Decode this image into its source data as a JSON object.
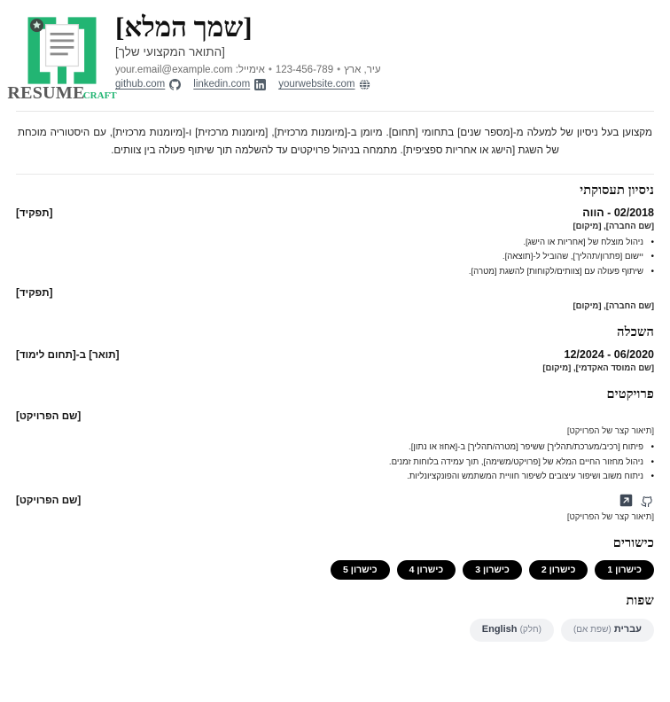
{
  "header": {
    "full_name": "[שמך המלא]",
    "job_title": "[התואר המקצועי שלך]",
    "location": "עיר, ארץ",
    "phone": "123-456-789",
    "email_label": "אימייל:",
    "email": "your.email@example.com",
    "separator": "•",
    "links": [
      {
        "icon": "github-icon",
        "text": "github.com"
      },
      {
        "icon": "linkedin-icon",
        "text": "linkedin.com"
      },
      {
        "icon": "globe-icon",
        "text": "yourwebsite.com"
      }
    ],
    "logo": {
      "word_primary": "RESUME",
      "word_secondary": "CRAFT",
      "brand_green": "#22b573",
      "brand_gray": "#595959"
    }
  },
  "summary": {
    "text": "מקצוען בעל ניסיון של למעלה מ-[מספר שנים] בתחומי [תחום]. מיומן ב-[מיומנות מרכזית], [מיומנות מרכזית] ו-[מיומנות מרכזית], עם היסטוריה מוכחת של השגת [הישג או אחריות ספציפית]. מתמחה בניהול פרויקטים עד להשלמה תוך שיתוף פעולה בין צוותים."
  },
  "experience": {
    "title": "ניסיון תעסוקתי",
    "entries": [
      {
        "role": "[תפקיד]",
        "date": "02/2018 - הווה",
        "sub": "[שם החברה], [מיקום]",
        "bullets": [
          "ניהול מוצלח של [אחריות או הישג].",
          "יישום [פתרון/תהליך], שהוביל ל-[תוצאה].",
          "שיתוף פעולה עם [צוותים/לקוחות] להשגת [מטרה]."
        ]
      },
      {
        "role": "[תפקיד]",
        "date": "",
        "sub": "[שם החברה], [מיקום]",
        "bullets": []
      }
    ]
  },
  "education": {
    "title": "השכלה",
    "entries": [
      {
        "degree": "[תואר] ב-[תחום לימוד]",
        "date": "12/2024 - 06/2020",
        "sub": "[שם המוסד האקדמי], [מיקום]"
      }
    ]
  },
  "projects": {
    "title": "פרויקטים",
    "entries": [
      {
        "name": "[שם הפרויקט]",
        "desc": "[תיאור קצר של הפרויקט]",
        "icons": [],
        "bullets": [
          "פיתוח [רכיב/מערכת/תהליך] ששיפר [מטרה/תהליך] ב-[אחוז או נתון].",
          "ניהול מחזור החיים המלא של [פרויקט/משימה], תוך עמידה בלוחות זמנים.",
          "ניתוח משוב ושיפור עיצובים לשיפור חוויית המשתמש והפונקציונליות."
        ]
      },
      {
        "name": "[שם הפרויקט]",
        "desc": "[תיאור קצר של הפרויקט]",
        "icons": [
          "github-icon",
          "external-link-icon"
        ],
        "bullets": []
      }
    ]
  },
  "skills": {
    "title": "כישורים",
    "items": [
      "כישרון 1",
      "כישרון 2",
      "כישרון 3",
      "כישרון 4",
      "כישרון 5"
    ]
  },
  "languages": {
    "title": "שפות",
    "items": [
      {
        "name": "עברית",
        "level": "(שפת אם)"
      },
      {
        "name": "English",
        "level": "(חלק)"
      }
    ]
  }
}
